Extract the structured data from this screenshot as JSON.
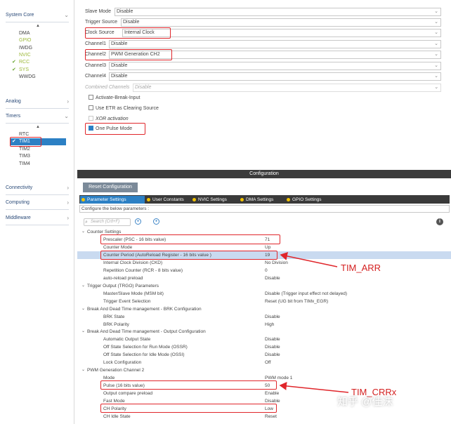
{
  "sidebar": {
    "categories": {
      "system_core": "System Core",
      "analog": "Analog",
      "timers": "Timers",
      "connectivity": "Connectivity",
      "computing": "Computing",
      "middleware": "Middleware"
    },
    "system_core_items": [
      "DMA",
      "GPIO",
      "IWDG",
      "NVIC",
      "RCC",
      "SYS",
      "WWDG"
    ],
    "timer_items": [
      "RTC",
      "TIM1",
      "TIM2",
      "TIM3",
      "TIM4"
    ]
  },
  "mode": {
    "slave_mode": {
      "label": "Slave Mode",
      "value": "Disable"
    },
    "trigger_source": {
      "label": "Trigger Source",
      "value": "Disable"
    },
    "clock_source": {
      "label": "Clock Source",
      "value": "Internal Clock"
    },
    "channel1": {
      "label": "Channel1",
      "value": "Disable"
    },
    "channel2": {
      "label": "Channel2",
      "value": "PWM Generation CH2"
    },
    "channel3": {
      "label": "Channel3",
      "value": "Disable"
    },
    "channel4": {
      "label": "Channel4",
      "value": "Disable"
    },
    "combined_channels": {
      "label": "Combined Channels",
      "value": "Disable"
    },
    "activate_break_input": "Activate-Break-Input",
    "use_etr": "Use ETR as Clearing Source",
    "xor_activation": "XOR activation",
    "one_pulse_mode": "One Pulse Mode"
  },
  "config": {
    "title": "Configuration",
    "reset_button": "Reset Configuration",
    "tabs": [
      "Parameter Settings",
      "User Constants",
      "NVIC Settings",
      "DMA Settings",
      "GPIO Settings"
    ],
    "hint": "Configure the below parameters :",
    "search_placeholder": "Search (Crtl+F)"
  },
  "params": {
    "counter_settings": "Counter Settings",
    "prescaler": {
      "name": "Prescaler (PSC - 16 bits value)",
      "value": "71"
    },
    "counter_mode": {
      "name": "Counter Mode",
      "value": "Up"
    },
    "counter_period": {
      "name": "Counter Period (AutoReload Register - 16 bits value )",
      "value": "19"
    },
    "internal_clock_division": {
      "name": "Internal Clock Division (CKD)",
      "value": "No Division"
    },
    "repetition_counter": {
      "name": "Repetition Counter (RCR - 8 bits value)",
      "value": "0"
    },
    "auto_reload": {
      "name": "auto-reload preload",
      "value": "Disable"
    },
    "trgo_group": "Trigger Output (TRGO) Parameters",
    "msm": {
      "name": "Master/Slave Mode (MSM bit)",
      "value": "Disable (Trigger input effect not delayed)"
    },
    "trigger_event": {
      "name": "Trigger Event Selection",
      "value": "Reset (UG bit from TIMx_EGR)"
    },
    "brk_group": "Break And Dead Time management - BRK Configuration",
    "brk_state": {
      "name": "BRK State",
      "value": "Disable"
    },
    "brk_polarity": {
      "name": "BRK Polarity",
      "value": "High"
    },
    "output_group": "Break And Dead Time management - Output Configuration",
    "auto_output": {
      "name": "Automatic Output State",
      "value": "Disable"
    },
    "ossr": {
      "name": "Off State Selection for Run Mode (OSSR)",
      "value": "Disable"
    },
    "ossi": {
      "name": "Off State Selection for Idle Mode (OSSI)",
      "value": "Disable"
    },
    "lock_config": {
      "name": "Lock Configuration",
      "value": "Off"
    },
    "pwm_group": "PWM Generation Channel 2",
    "pwm_mode": {
      "name": "Mode",
      "value": "PWM mode 1"
    },
    "pulse": {
      "name": "Pulse (16 bits value)",
      "value": "50"
    },
    "output_compare_preload": {
      "name": "Output compare preload",
      "value": "Enable"
    },
    "fast_mode": {
      "name": "Fast Mode",
      "value": "Disable"
    },
    "ch_polarity": {
      "name": "CH Polarity",
      "value": "Low"
    },
    "ch_idle_state": {
      "name": "CH Idle State",
      "value": "Reset"
    }
  },
  "annotations": {
    "arr": "TIM_ARR",
    "crr": "TIM_CRRx",
    "watermark": "知乎 @佳沫"
  }
}
